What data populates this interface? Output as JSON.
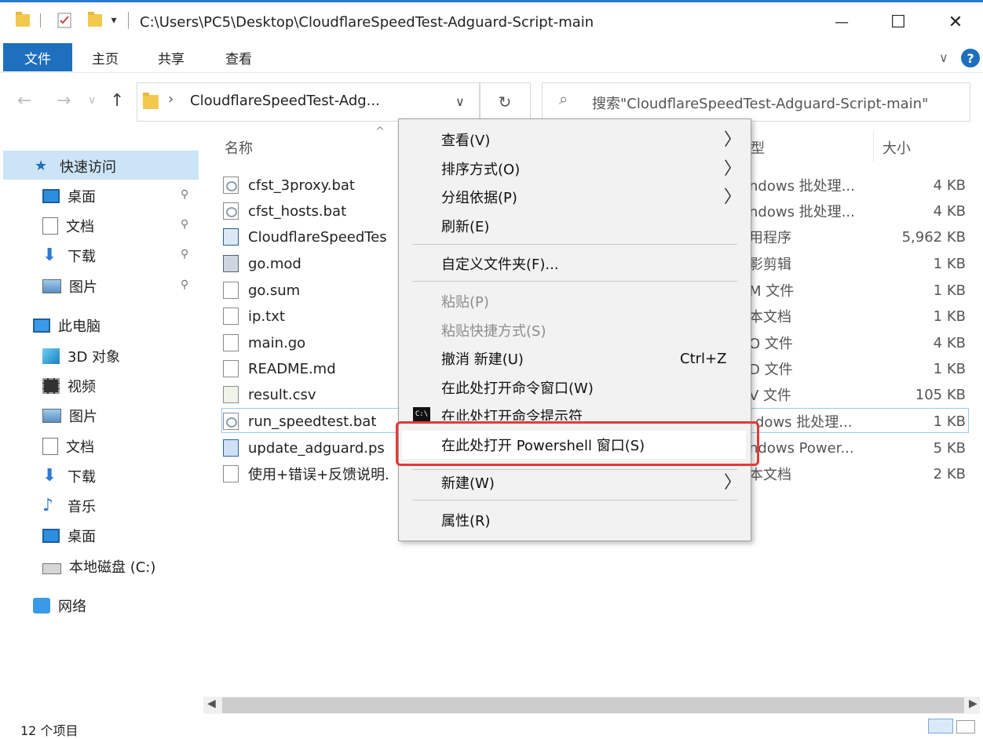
{
  "window": {
    "title": "C:\\Users\\PC5\\Desktop\\CloudflareSpeedTest-Adguard-Script-main",
    "minimize": "—",
    "maximize": "☐",
    "close": "✕"
  },
  "quick_access_toolbar": {
    "dropdown_glyph": "▾"
  },
  "ribbon": {
    "tabs": [
      "文件",
      "主页",
      "共享",
      "查看"
    ],
    "help": "?",
    "expand_glyph": "∨"
  },
  "nav": {
    "back": "←",
    "forward": "→",
    "recent": "∨",
    "up": "↑",
    "breadcrumb_sep": "›",
    "address": "CloudflareSpeedTest-Adg...",
    "address_dropdown": "∨",
    "refresh": "↻",
    "search_placeholder": "搜索\"CloudflareSpeedTest-Adguard-Script-main\"",
    "search_icon": "⌕"
  },
  "navpane": {
    "items": [
      {
        "label": "快速访问",
        "icon": "star-icon"
      },
      {
        "label": "桌面",
        "icon": "desktop-icon",
        "pinned": true
      },
      {
        "label": "文档",
        "icon": "document-icon",
        "pinned": true
      },
      {
        "label": "下载",
        "icon": "download-icon",
        "pinned": true
      },
      {
        "label": "图片",
        "icon": "picture-icon",
        "pinned": true
      },
      {
        "label": "此电脑",
        "icon": "computer-icon"
      },
      {
        "label": "3D 对象",
        "icon": "cube-icon"
      },
      {
        "label": "视频",
        "icon": "video-icon"
      },
      {
        "label": "图片",
        "icon": "picture-icon"
      },
      {
        "label": "文档",
        "icon": "document-icon"
      },
      {
        "label": "下载",
        "icon": "download-icon"
      },
      {
        "label": "音乐",
        "icon": "music-icon"
      },
      {
        "label": "桌面",
        "icon": "desktop-icon"
      },
      {
        "label": "本地磁盘 (C:)",
        "icon": "drive-icon"
      },
      {
        "label": "网络",
        "icon": "network-icon"
      }
    ],
    "pin_glyph": "📌"
  },
  "filelist": {
    "columns": {
      "name": "名称",
      "type": "型",
      "size": "大小"
    },
    "sort_glyph": "^",
    "files": [
      {
        "name": "cfst_3proxy.bat",
        "type": "ndows 批处理...",
        "size": "4 KB",
        "icon": "bat"
      },
      {
        "name": "cfst_hosts.bat",
        "type": "ndows 批处理...",
        "size": "4 KB",
        "icon": "bat"
      },
      {
        "name": "CloudflareSpeedTes",
        "type": "用程序",
        "size": "5,962 KB",
        "icon": "exe"
      },
      {
        "name": "go.mod",
        "type": "影剪辑",
        "size": "1 KB",
        "icon": "mod"
      },
      {
        "name": "go.sum",
        "type": "M 文件",
        "size": "1 KB",
        "icon": "file"
      },
      {
        "name": "ip.txt",
        "type": "本文档",
        "size": "1 KB",
        "icon": "txt"
      },
      {
        "name": "main.go",
        "type": "O 文件",
        "size": "4 KB",
        "icon": "file"
      },
      {
        "name": "README.md",
        "type": "D 文件",
        "size": "1 KB",
        "icon": "file"
      },
      {
        "name": "result.csv",
        "type": "V 文件",
        "size": "105 KB",
        "icon": "csv"
      },
      {
        "name": "run_speedtest.bat",
        "type": "dows 批处理...",
        "size": "1 KB",
        "icon": "bat"
      },
      {
        "name": "update_adguard.ps",
        "type": "ndows Power...",
        "size": "5 KB",
        "icon": "ps"
      },
      {
        "name": "使用+错误+反馈说明.",
        "type": "本文档",
        "size": "2 KB",
        "icon": "txt"
      }
    ]
  },
  "context_menu": {
    "items": [
      {
        "label": "查看(V)",
        "submenu": true
      },
      {
        "label": "排序方式(O)",
        "submenu": true
      },
      {
        "label": "分组依据(P)",
        "submenu": true
      },
      {
        "label": "刷新(E)"
      },
      {
        "label": "自定义文件夹(F)..."
      },
      {
        "label": "粘贴(P)",
        "disabled": true
      },
      {
        "label": "粘贴快捷方式(S)",
        "disabled": true
      },
      {
        "label": "撤消 新建(U)",
        "shortcut": "Ctrl+Z"
      },
      {
        "label": "在此处打开命令窗口(W)"
      },
      {
        "label": "在此处打开命令提示符"
      },
      {
        "label": "在此处打开 Powershell 窗口(S)",
        "highlighted": true
      },
      {
        "label": "新建(W)",
        "submenu": true
      },
      {
        "label": "属性(R)"
      }
    ],
    "submenu_glyph": "〉",
    "cmd_icon_text": "C:\\"
  },
  "statusbar": {
    "count": "12 个项目"
  },
  "colors": {
    "accent": "#1e6fbd",
    "selection": "#cce4f7",
    "highlight_box": "#e53935"
  }
}
